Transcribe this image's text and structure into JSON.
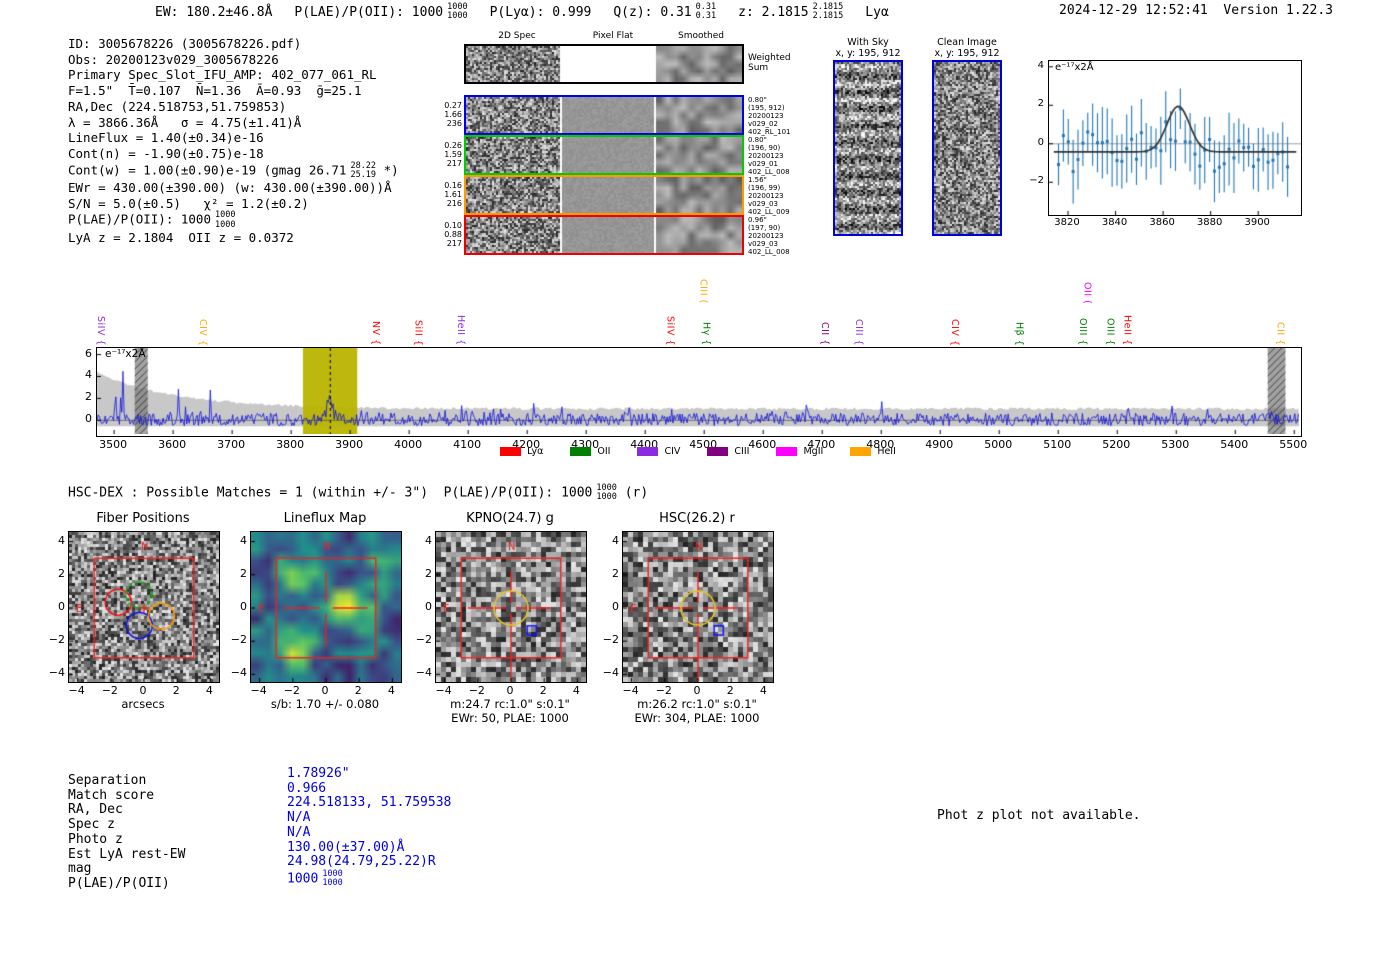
{
  "header": {
    "segments": [
      {
        "text": "EW: 180.2±46.8Å"
      },
      {
        "text": "P(LAE)/P(OII): 1000",
        "frac": {
          "num": "1000",
          "den": "1000"
        }
      },
      {
        "text": "P(Lyα): 0.999"
      },
      {
        "text": "Q(z): 0.31",
        "frac": {
          "num": "0.31",
          "den": "0.31"
        }
      },
      {
        "text": "z: 2.1815",
        "frac": {
          "num": "2.1815",
          "den": "2.1815"
        }
      },
      {
        "text": "Lyα"
      }
    ],
    "datetime": "2024-12-29 12:52:41",
    "version": "Version 1.22.3"
  },
  "info": {
    "lines": [
      {
        "text": "ID: 3005678226 (3005678226.pdf)"
      },
      {
        "text": "Obs: 20200123v029_3005678226"
      },
      {
        "text": "Primary Spec_Slot_IFU_AMP: 402_077_061_RL"
      },
      {
        "text": "F=1.5\"  T̄=0.107  N̄=1.36  Ā=0.93  ḡ=25.1"
      },
      {
        "text": "RA,Dec (224.518753,51.759853)"
      },
      {
        "text": "λ = 3866.36Å   σ = 4.75(±1.41)Å"
      },
      {
        "text": "LineFlux = 1.40(±0.34)e-16"
      },
      {
        "text": "Cont(n) = -1.90(±0.75)e-18"
      },
      {
        "text": "Cont(w) = 1.00(±0.90)e-19 (gmag 26.71",
        "frac": {
          "num": "28.22",
          "den": "25.19"
        },
        "suffix": " *)"
      },
      {
        "text": "EWr = 430.00(±390.00) (w: 430.00(±390.00))Å"
      },
      {
        "text": "S/N = 5.0(±0.5)   χ² = 1.2(±0.2)"
      },
      {
        "text": "P(LAE)/P(OII): 1000",
        "frac": {
          "num": "1000",
          "den": "1000"
        }
      },
      {
        "text": "LyA z = 2.1804  OII z = 0.0372"
      }
    ]
  },
  "spec2d": {
    "col_titles": [
      "2D Spec",
      "Pixel Flat",
      "Smoothed"
    ],
    "weighted_sum_label": "Weighted Sum",
    "rows": [
      {
        "border": "#0000ee",
        "left": [
          "0.27",
          "1.66",
          "236"
        ],
        "right": [
          "0.80\"",
          "(195, 912)",
          "20200123",
          "v029_02",
          "402_RL_101"
        ]
      },
      {
        "border": "#00cc00",
        "left": [
          "0.26",
          "1.59",
          "217"
        ],
        "right": [
          "0.80\"",
          "(196, 90)",
          "20200123",
          "v029_01",
          "402_LL_008"
        ]
      },
      {
        "border": "#ff9900",
        "left": [
          "0.16",
          "1.61",
          "216"
        ],
        "right": [
          "1.56\"",
          "(196, 99)",
          "20200123",
          "v029_03",
          "402_LL_009"
        ]
      },
      {
        "border": "#ee0000",
        "left": [
          "0.10",
          "0.88",
          "217"
        ],
        "right": [
          "0.96\"",
          "(197, 90)",
          "20200123",
          "v029_03",
          "402_LL_008"
        ]
      }
    ]
  },
  "sky_panels": {
    "left": {
      "title": "With Sky",
      "subtitle": "x, y: 195, 912"
    },
    "right": {
      "title": "Clean Image",
      "subtitle": "x, y: 195, 912"
    }
  },
  "hsc_line": {
    "text": "HSC-DEX : Possible Matches = 1 (within +/- 3\")  P(LAE)/P(OII): 1000",
    "frac": {
      "num": "1000",
      "den": "1000"
    },
    "suffix": " (r)"
  },
  "match_table": {
    "rows": [
      {
        "label": "Separation",
        "value": "1.78926\""
      },
      {
        "label": "Match score",
        "value": "0.966"
      },
      {
        "label": "RA, Dec",
        "value": "224.518133, 51.759538"
      },
      {
        "label": "Spec z",
        "value": "N/A"
      },
      {
        "label": "Photo z",
        "value": "N/A"
      },
      {
        "label": "Est LyA rest-EW",
        "value": "130.00(±37.00)Å"
      },
      {
        "label": "mag",
        "value": "24.98(24.79,25.22)R"
      },
      {
        "label": "P(LAE)/P(OII)",
        "value": "1000",
        "frac": {
          "num": "1000",
          "den": "1000"
        }
      }
    ]
  },
  "notes": {
    "photz": "Phot z plot not available."
  },
  "chart_data": [
    {
      "id": "line_fit_zoom",
      "type": "scatter",
      "ylabel": "e⁻¹⁷x2Å",
      "xlim": [
        3812,
        3918
      ],
      "ylim": [
        -3.7,
        4.3
      ],
      "xticks": [
        3820,
        3840,
        3860,
        3880,
        3900
      ],
      "yticks": [
        4,
        2,
        0,
        -2
      ],
      "fit": {
        "shape": "gaussian",
        "center": 3866.36,
        "sigma": 4.75,
        "amplitude": 2.37,
        "baseline": -0.42
      },
      "point_color": "#2577b4",
      "fit_color": "#333333",
      "description": "Blue errorbar flux points vs wavelength with black Gaussian emission-line fit at 3866.36Å"
    },
    {
      "id": "full_spectrum",
      "type": "line",
      "ylabel": "e⁻¹⁷x2Å",
      "xlim": [
        3471,
        5508
      ],
      "ylim": [
        -1.25,
        6.6
      ],
      "xticks": [
        3500,
        3600,
        3700,
        3800,
        3900,
        4000,
        4100,
        4200,
        4300,
        4400,
        4500,
        4600,
        4700,
        4800,
        4900,
        5000,
        5100,
        5200,
        5300,
        5400,
        5500
      ],
      "yticks": [
        6,
        4,
        2,
        0
      ],
      "line_color": "#1010dd",
      "noise_envelope_color": "#c8c8c8",
      "selected_band": {
        "from": 3820,
        "to": 3912,
        "color": "#b9b400"
      },
      "line_center": 3866.36,
      "masked_bands": [
        [
          3535,
          3557
        ],
        [
          5455,
          5485
        ]
      ],
      "emission_labels": [
        {
          "label": "SiIV",
          "brace": "{",
          "wavelength": 3481,
          "color": "#8a2be2",
          "raised": false
        },
        {
          "label": "CIV",
          "brace": "{",
          "wavelength": 3654,
          "color": "#ffa500",
          "raised": false
        },
        {
          "label": "NV",
          "brace": "{",
          "wavelength": 3947,
          "color": "#ff0000",
          "raised": false
        },
        {
          "label": "SiII",
          "brace": "{",
          "wavelength": 4019,
          "color": "#ff0000",
          "raised": false
        },
        {
          "label": "HeII",
          "brace": "{",
          "wavelength": 4091,
          "color": "#8a2be2",
          "raised": false
        },
        {
          "label": "SiIV",
          "brace": "{",
          "wavelength": 4446,
          "color": "#ff0000",
          "raised": false
        },
        {
          "label": "CIII",
          "brace": "(",
          "wavelength": 4502,
          "color": "#ffa500",
          "raised": true
        },
        {
          "label": "Hγ",
          "brace": "{",
          "wavelength": 4507,
          "color": "#008000",
          "raised": false
        },
        {
          "label": "CII",
          "brace": "{",
          "wavelength": 4708,
          "color": "#800080",
          "raised": false
        },
        {
          "label": "CIII",
          "brace": "{",
          "wavelength": 4766,
          "color": "#8a2be2",
          "raised": false
        },
        {
          "label": "CIV",
          "brace": "{",
          "wavelength": 4928,
          "color": "#ff0000",
          "raised": false
        },
        {
          "label": "Hβ",
          "brace": "{",
          "wavelength": 5038,
          "color": "#008000",
          "raised": false
        },
        {
          "label": "OIII",
          "brace": "{",
          "wavelength": 5145,
          "color": "#008000",
          "raised": false
        },
        {
          "label": "OII",
          "brace": "(",
          "wavelength": 5153,
          "color": "#ff00ff",
          "raised": true
        },
        {
          "label": "OIII",
          "brace": "{",
          "wavelength": 5192,
          "color": "#008000",
          "raised": false
        },
        {
          "label": "HeII",
          "brace": "{",
          "wavelength": 5221,
          "color": "#ff0000",
          "raised": false
        },
        {
          "label": "CII",
          "brace": "{",
          "wavelength": 5480,
          "color": "#ffa500",
          "raised": false
        }
      ],
      "legend": [
        {
          "label": "Lyα",
          "color": "#ff0000"
        },
        {
          "label": "OII",
          "color": "#008000"
        },
        {
          "label": "CIV",
          "color": "#8a2be2"
        },
        {
          "label": "CIII",
          "color": "#800080"
        },
        {
          "label": "MgII",
          "color": "#ff00ff"
        },
        {
          "label": "HeII",
          "color": "#ffa500"
        }
      ]
    },
    {
      "id": "cutouts",
      "type": "heatmap",
      "xticks": [
        -4,
        -2,
        0,
        2,
        4
      ],
      "yticks": [
        4,
        2,
        0,
        -2,
        -4
      ],
      "panels": [
        {
          "title": "Fiber Positions",
          "xlabel": "arcsecs",
          "style": "fibers",
          "compass": [
            "N",
            "E"
          ]
        },
        {
          "title": "Lineflux Map",
          "xlabel": "s/b: 1.70 +/- 0.080",
          "style": "viridis",
          "compass": [
            "N",
            "E"
          ]
        },
        {
          "title": "KPNO(24.7) g",
          "xlabel": "m:24.7 rc:1.0\"  s:0.1\"",
          "footnote": "EWr: 50, PLAE: 1000",
          "style": "gray",
          "compass": [
            "N",
            "E"
          ]
        },
        {
          "title": "HSC(26.2) r",
          "xlabel": "m:26.2 rc:1.0\"  s:0.1\"",
          "footnote": "EWr: 304, PLAE: 1000",
          "style": "gray",
          "compass": [
            "N",
            "E"
          ]
        }
      ]
    }
  ]
}
